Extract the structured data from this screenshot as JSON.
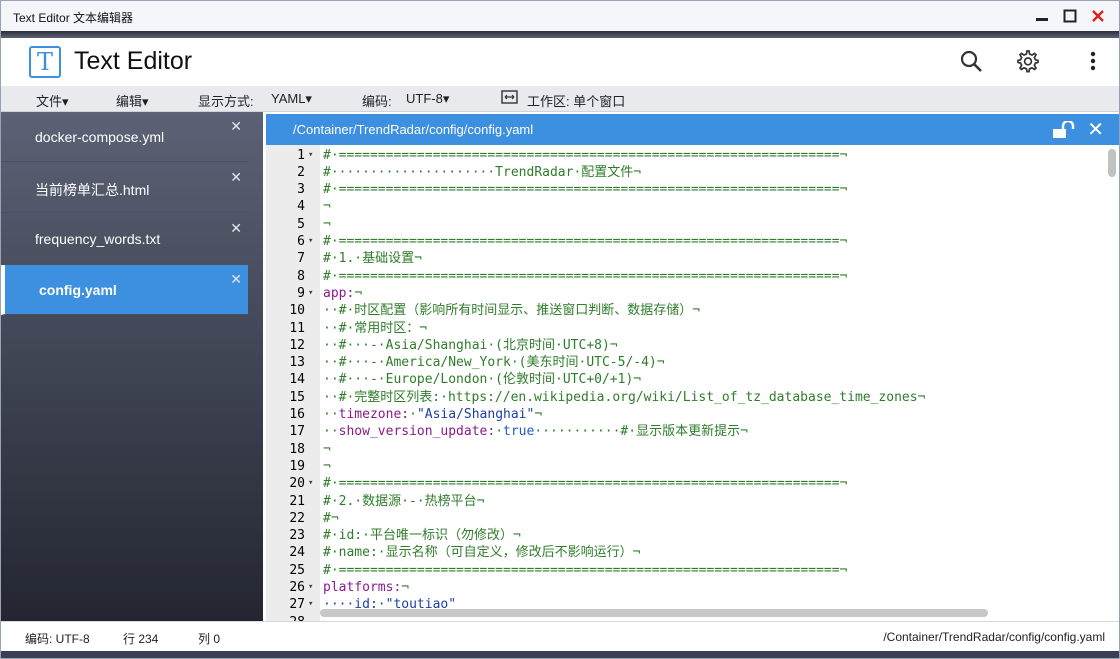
{
  "window": {
    "title": "Text Editor 文本编辑器"
  },
  "header": {
    "app_title": "Text Editor",
    "logo_letter": "T"
  },
  "menubar": {
    "file": "文件▾",
    "edit": "编辑▾",
    "display_label": "显示方式:",
    "display_value": "YAML▾",
    "encoding_label": "编码:",
    "encoding_value": "UTF-8▾",
    "workspace": "工作区: 单个窗口"
  },
  "tabs": [
    {
      "label": "docker-compose.yml",
      "close": "✕"
    },
    {
      "label": "当前榜单汇总.html",
      "close": "✕"
    },
    {
      "label": "frequency_words.txt",
      "close": "✕"
    },
    {
      "label": "config.yaml",
      "close": "✕",
      "active": true
    }
  ],
  "editor": {
    "path": "/Container/TrendRadar/config/config.yaml",
    "close": "✕",
    "lines": [
      {
        "n": "1",
        "fold": "▾",
        "parts": [
          {
            "t": "#·================================================================¬",
            "c": "comment"
          }
        ]
      },
      {
        "n": "2",
        "fold": "",
        "parts": [
          {
            "t": "#·····················TrendRadar·配置文件¬",
            "c": "comment"
          }
        ]
      },
      {
        "n": "3",
        "fold": "",
        "parts": [
          {
            "t": "#·================================================================¬",
            "c": "comment"
          }
        ]
      },
      {
        "n": "4",
        "fold": "",
        "parts": [
          {
            "t": "¬",
            "c": "comment"
          }
        ]
      },
      {
        "n": "5",
        "fold": "",
        "parts": [
          {
            "t": "¬",
            "c": "comment"
          }
        ]
      },
      {
        "n": "6",
        "fold": "▾",
        "parts": [
          {
            "t": "#·================================================================¬",
            "c": "comment"
          }
        ]
      },
      {
        "n": "7",
        "fold": "",
        "parts": [
          {
            "t": "#·1.·基础设置¬",
            "c": "comment"
          }
        ]
      },
      {
        "n": "8",
        "fold": "",
        "parts": [
          {
            "t": "#·================================================================¬",
            "c": "comment"
          }
        ]
      },
      {
        "n": "9",
        "fold": "▾",
        "parts": [
          {
            "t": "app:",
            "c": "key"
          },
          {
            "t": "¬",
            "c": "comment"
          }
        ]
      },
      {
        "n": "10",
        "fold": "",
        "parts": [
          {
            "t": "··#·时区配置（影响所有时间显示、推送窗口判断、数据存储）¬",
            "c": "comment"
          }
        ]
      },
      {
        "n": "11",
        "fold": "",
        "parts": [
          {
            "t": "··#·常用时区：¬",
            "c": "comment"
          }
        ]
      },
      {
        "n": "12",
        "fold": "",
        "parts": [
          {
            "t": "··#···-·Asia/Shanghai·(北京时间·UTC+8)¬",
            "c": "comment"
          }
        ]
      },
      {
        "n": "13",
        "fold": "",
        "parts": [
          {
            "t": "··#···-·America/New_York·(美东时间·UTC-5/-4)¬",
            "c": "comment"
          }
        ]
      },
      {
        "n": "14",
        "fold": "",
        "parts": [
          {
            "t": "··#···-·Europe/London·(伦敦时间·UTC+0/+1)¬",
            "c": "comment"
          }
        ]
      },
      {
        "n": "15",
        "fold": "",
        "parts": [
          {
            "t": "··#·完整时区列表:·https://en.wikipedia.org/wiki/List_of_tz_database_time_zones¬",
            "c": "comment"
          }
        ]
      },
      {
        "n": "16",
        "fold": "",
        "parts": [
          {
            "t": "··",
            "c": "comment"
          },
          {
            "t": "timezone:",
            "c": "key"
          },
          {
            "t": "·",
            "c": "comment"
          },
          {
            "t": "\"Asia/Shanghai\"",
            "c": "str"
          },
          {
            "t": "¬",
            "c": "comment"
          }
        ]
      },
      {
        "n": "17",
        "fold": "",
        "parts": [
          {
            "t": "··",
            "c": "comment"
          },
          {
            "t": "show_version_update:",
            "c": "key"
          },
          {
            "t": "·",
            "c": "comment"
          },
          {
            "t": "true",
            "c": "bool"
          },
          {
            "t": "···········#·显示版本更新提示¬",
            "c": "comment"
          }
        ]
      },
      {
        "n": "18",
        "fold": "",
        "parts": [
          {
            "t": "¬",
            "c": "comment"
          }
        ]
      },
      {
        "n": "19",
        "fold": "",
        "parts": [
          {
            "t": "¬",
            "c": "comment"
          }
        ]
      },
      {
        "n": "20",
        "fold": "▾",
        "parts": [
          {
            "t": "#·================================================================¬",
            "c": "comment"
          }
        ]
      },
      {
        "n": "21",
        "fold": "",
        "parts": [
          {
            "t": "#·2.·数据源·-·热榜平台¬",
            "c": "comment"
          }
        ]
      },
      {
        "n": "22",
        "fold": "",
        "parts": [
          {
            "t": "#¬",
            "c": "comment"
          }
        ]
      },
      {
        "n": "23",
        "fold": "",
        "parts": [
          {
            "t": "#·id:·平台唯一标识（勿修改）¬",
            "c": "comment"
          }
        ]
      },
      {
        "n": "24",
        "fold": "",
        "parts": [
          {
            "t": "#·name:·显示名称（可自定义，修改后不影响运行）¬",
            "c": "comment"
          }
        ]
      },
      {
        "n": "25",
        "fold": "",
        "parts": [
          {
            "t": "#·================================================================¬",
            "c": "comment"
          }
        ]
      },
      {
        "n": "26",
        "fold": "▾",
        "parts": [
          {
            "t": "platforms:",
            "c": "key"
          },
          {
            "t": "¬",
            "c": "comment"
          }
        ]
      },
      {
        "n": "27",
        "fold": "▾",
        "parts": [
          {
            "t": "····id:·\"toutiao\"",
            "c": "str"
          }
        ]
      },
      {
        "n": "28",
        "fold": "",
        "parts": [
          {
            "t": "",
            "c": "comment"
          }
        ]
      }
    ]
  },
  "status": {
    "encoding": "编码: UTF-8",
    "line": "行 234",
    "column": "列 0",
    "path": "/Container/TrendRadar/config/config.yaml"
  }
}
